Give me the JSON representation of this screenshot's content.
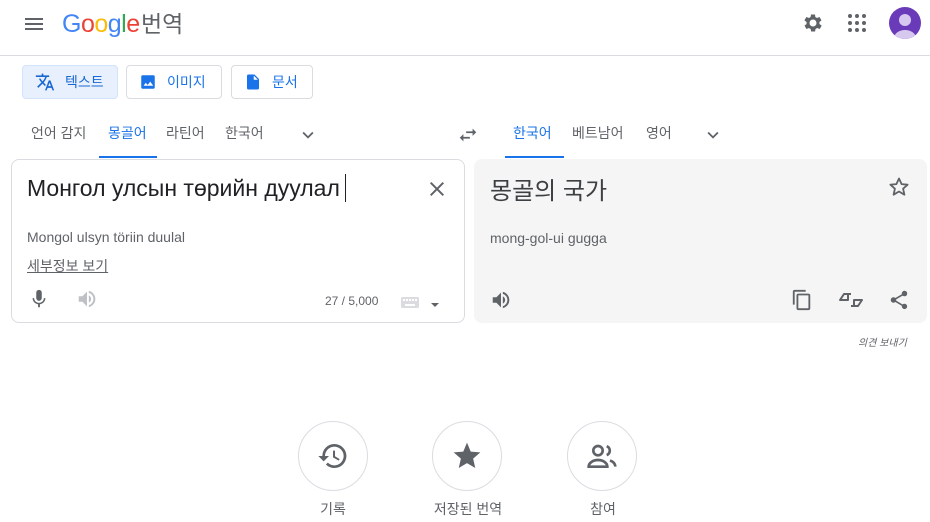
{
  "header": {
    "logo": {
      "G": "G",
      "o1": "o",
      "o2": "o",
      "g": "g",
      "l": "l",
      "e": "e"
    },
    "app_name": "번역"
  },
  "modes": [
    {
      "label": "텍스트",
      "icon": "translate-icon",
      "active": true
    },
    {
      "label": "이미지",
      "icon": "image-icon",
      "active": false
    },
    {
      "label": "문서",
      "icon": "document-icon",
      "active": false
    }
  ],
  "source": {
    "langs": [
      "언어 감지",
      "몽골어",
      "라틴어",
      "한국어"
    ],
    "active_index": 1,
    "text": "Монгол улсын төрийн дуулал",
    "transliteration": "Mongol ulsyn töriin duulal",
    "details_link": "세부정보 보기",
    "char_count": "27 / 5,000"
  },
  "target": {
    "langs": [
      "한국어",
      "베트남어",
      "영어"
    ],
    "active_index": 0,
    "text": "몽골의 국가",
    "transliteration": "mong-gol-ui gugga",
    "feedback": "의견 보내기"
  },
  "bottom": [
    {
      "label": "기록",
      "icon": "history-icon"
    },
    {
      "label": "저장된 번역",
      "icon": "star-icon"
    },
    {
      "label": "참여",
      "icon": "people-icon"
    }
  ],
  "colors": {
    "accent": "#1a73e8",
    "avatar": "#6a3bb8"
  }
}
